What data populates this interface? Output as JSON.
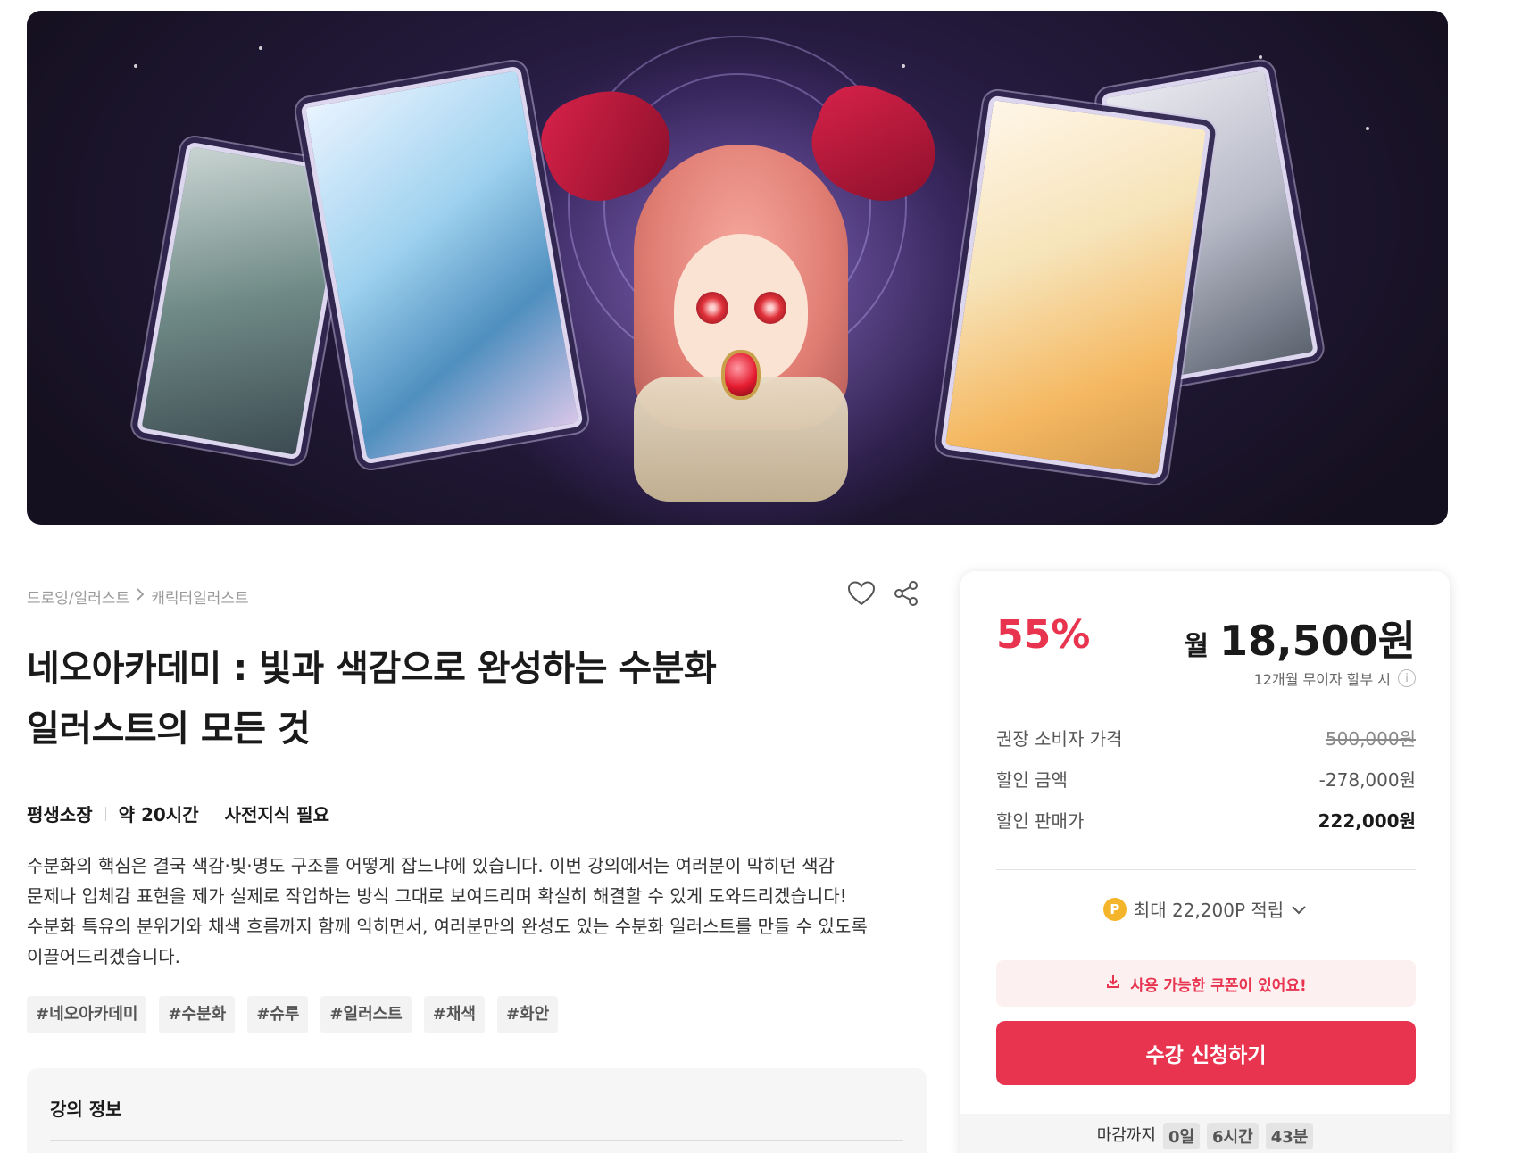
{
  "breadcrumb": {
    "category": "드로잉/일러스트",
    "subcategory": "캐릭터일러스트"
  },
  "icons": {
    "heart": "heart-icon",
    "share": "share-icon",
    "info": "info-icon",
    "point": "point-coin-icon",
    "chevron": "chevron-down-icon",
    "download": "download-icon"
  },
  "course": {
    "title_line1": "네오아카데미 : 빛과 색감으로 완성하는 수분화",
    "title_line2": "일러스트의 모든 것",
    "meta": [
      "평생소장",
      "약 20시간",
      "사전지식 필요"
    ],
    "description": [
      "수분화의 핵심은 결국 색감·빛·명도 구조를 어떻게 잡느냐에 있습니다. 이번 강의에서는 여러분이 막히던 색감",
      "문제나 입체감 표현을 제가 실제로 작업하는 방식 그대로 보여드리며 확실히 해결할 수 있게 도와드리겠습니다!",
      "수분화 특유의 분위기와 채색 흐름까지 함께 익히면서, 여러분만의 완성도 있는 수분화 일러스트를 만들 수 있도록",
      "이끌어드리겠습니다."
    ],
    "tags": [
      "#네오아카데미",
      "#수분화",
      "#슈루",
      "#일러스트",
      "#채색",
      "#화안"
    ],
    "info_title": "강의 정보"
  },
  "pricing": {
    "discount": "55%",
    "monthly_unit": "월",
    "monthly_amount": "18,500원",
    "installment_note": "12개월 무이자 할부 시",
    "msrp_label": "권장 소비자 가격",
    "msrp_value": "500,000원",
    "discount_label": "할인 금액",
    "discount_value": "-278,000원",
    "sale_label": "할인 판매가",
    "sale_value": "222,000원",
    "points_text": "최대 22,200P 적립",
    "coupon_text": "사용 가능한 쿠폰이 있어요!",
    "enroll_label": "수강 신청하기",
    "deadline_label": "마감까지",
    "deadline_days": "0일",
    "deadline_hours": "6시간",
    "deadline_minutes": "43분"
  },
  "colors": {
    "accent": "#e8344e",
    "point": "#f5b52a"
  }
}
